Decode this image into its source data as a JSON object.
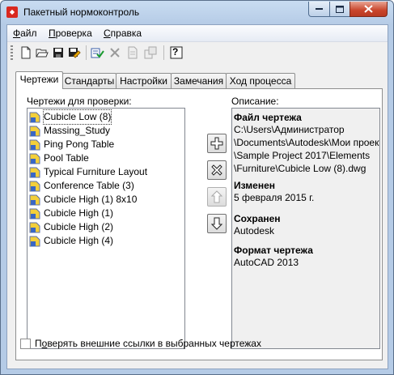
{
  "window": {
    "title": "Пакетный нормоконтроль",
    "colors": {
      "close_button": "#c9452b",
      "title_bar": "#c9dcf1"
    }
  },
  "menu": {
    "items": [
      {
        "label": "Файл",
        "accel": "Ф",
        "rest": "айл"
      },
      {
        "label": "Проверка",
        "accel": "П",
        "rest": "роверка"
      },
      {
        "label": "Справка",
        "accel": "С",
        "rest": "правка"
      }
    ]
  },
  "toolbar": {
    "icons": [
      "new-icon",
      "open-icon",
      "save-icon",
      "save-as-icon",
      "check-icon",
      "delete-icon",
      "copy-icon",
      "settings-icon",
      "help-icon"
    ],
    "help_glyph": "?"
  },
  "tabs": [
    {
      "label": "Чертежи",
      "active": true
    },
    {
      "label": "Стандарты",
      "active": false
    },
    {
      "label": "Настройки",
      "active": false
    },
    {
      "label": "Замечания",
      "active": false
    },
    {
      "label": "Ход процесса",
      "active": false
    }
  ],
  "drawings": {
    "label": "Чертежи для проверки:",
    "items": [
      "Cubicle Low (8)",
      "Massing_Study",
      "Ping Pong Table",
      "Pool Table",
      "Typical Furniture Layout",
      "Conference Table (3)",
      "Cubicle High (1) 8x10",
      "Cubicle High (1)",
      "Cubicle High (2)",
      "Cubicle High (4)"
    ],
    "selected_index": 0
  },
  "side_buttons": {
    "add": "+",
    "remove": "×",
    "up": "↑",
    "down": "↓"
  },
  "description": {
    "label": "Описание:",
    "file_heading": "Файл чертежа",
    "file_path": "C:\\Users\\Администратор\n\\Documents\\Autodesk\\Мои проекты\n\\Sample Project 2017\\Elements\n\\Furniture\\Cubicle Low (8).dwg",
    "modified_heading": "Изменен",
    "modified_value": "5 февраля 2015 г.",
    "saved_heading": "Сохранен",
    "saved_value": "Autodesk",
    "format_heading": "Формат чертежа",
    "format_value": "AutoCAD 2013"
  },
  "options": {
    "check_xrefs_label": "Проверять внешние ссылки в выбранных чертежах",
    "check_xrefs_accel": "о",
    "check_xrefs_checked": false
  }
}
